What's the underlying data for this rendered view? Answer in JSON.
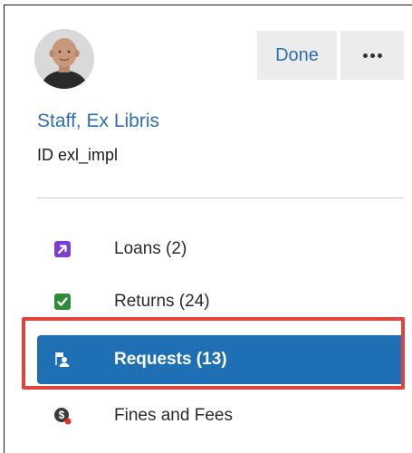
{
  "header": {
    "done_label": "Done",
    "more_icon": "more-horizontal-icon"
  },
  "user": {
    "name": "Staff, Ex Libris",
    "id_prefix": "ID",
    "id_value": "exl_impl"
  },
  "nav": {
    "items": [
      {
        "label": "Loans (2)",
        "icon": "loan-arrow-icon",
        "color": "#7b3fd0"
      },
      {
        "label": "Returns (24)",
        "icon": "return-check-icon",
        "color": "#2e8b3a"
      },
      {
        "label": "Requests (13)",
        "icon": "request-person-icon",
        "color": "#ffffff",
        "selected": true
      },
      {
        "label": "Fines and Fees",
        "icon": "fines-dollar-icon",
        "color": "#3a3a3a",
        "badge_color": "#e0302a"
      }
    ]
  },
  "colors": {
    "accent": "#2f6db5",
    "selected_bg": "#1f6fb5",
    "highlight_border": "#e0423c",
    "button_bg": "#ececec"
  }
}
